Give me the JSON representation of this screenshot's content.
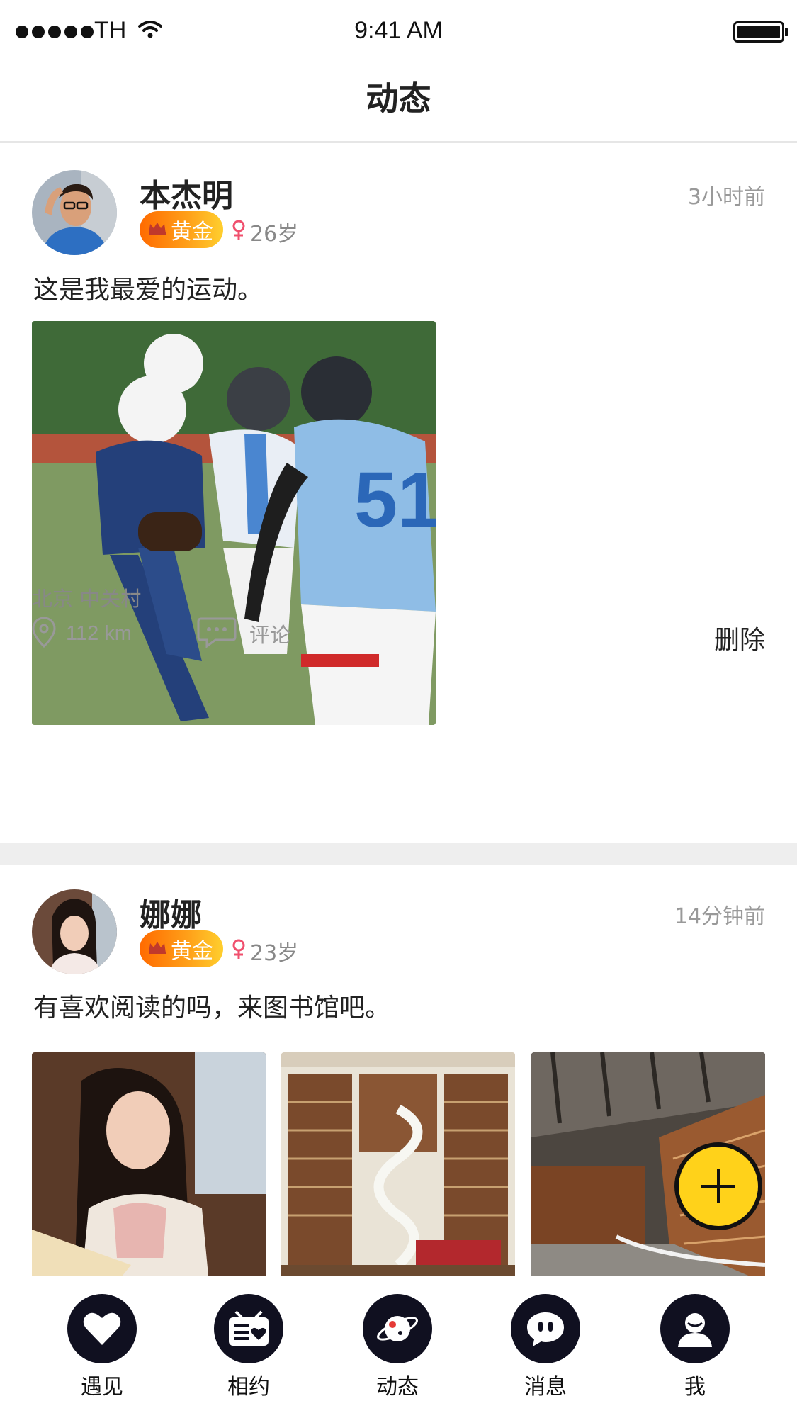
{
  "status_bar": {
    "carrier": "TH",
    "time": "9:41 AM"
  },
  "nav": {
    "title": "动态"
  },
  "posts": [
    {
      "username": "本杰明",
      "time_ago": "3小时前",
      "badge": "黄金",
      "age": "26岁",
      "text": "这是我最爱的运动。",
      "location": "北京 中关村",
      "distance": "112 km",
      "comment_label": "评论",
      "delete_label": "删除"
    },
    {
      "username": "娜娜",
      "time_ago": "14分钟前",
      "badge": "黄金",
      "age": "23岁",
      "text": "有喜欢阅读的吗，来图书馆吧。"
    }
  ],
  "tabs": [
    {
      "label": "遇见",
      "icon": "heart-icon"
    },
    {
      "label": "相约",
      "icon": "date-card-icon"
    },
    {
      "label": "动态",
      "icon": "planet-icon"
    },
    {
      "label": "消息",
      "icon": "chat-bubble-icon"
    },
    {
      "label": "我",
      "icon": "user-icon"
    }
  ],
  "colors": {
    "badge_start": "#ff6a00",
    "badge_end": "#ffcf2e",
    "fab": "#ffd21a",
    "gender_female": "#f0506e",
    "tab_icon_bg": "#101020"
  }
}
